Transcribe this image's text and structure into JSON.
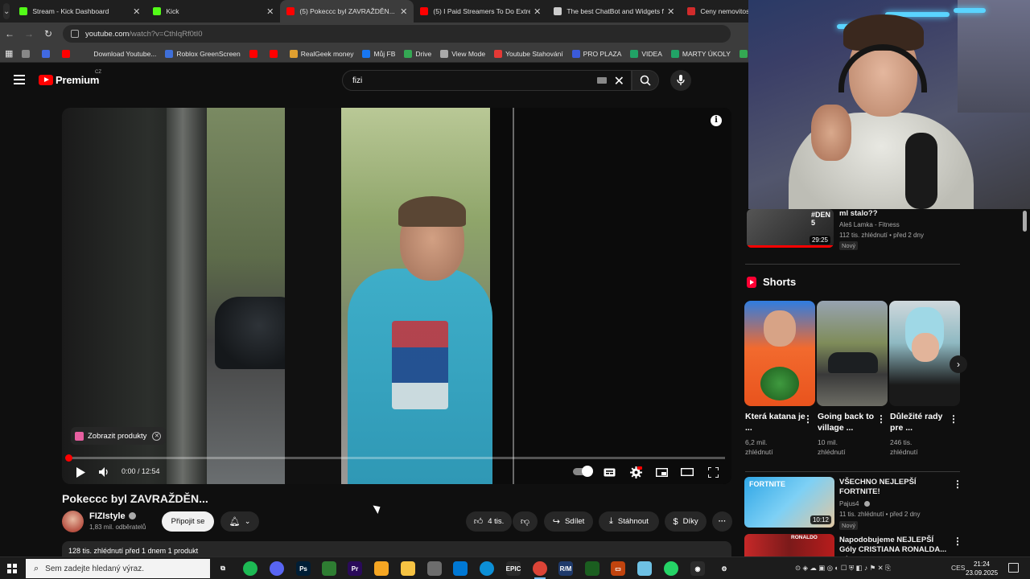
{
  "browser": {
    "tabs": [
      {
        "title": "Stream - Kick Dashboard",
        "color": "#53fc18",
        "active": false
      },
      {
        "title": "Kick",
        "color": "#53fc18",
        "active": false
      },
      {
        "title": "(5) Pokeccc byl ZAVRAŽDĚN...",
        "color": "#ff0000",
        "active": true
      },
      {
        "title": "(5) I Paid Streamers To Do Extre",
        "color": "#ff0000",
        "active": false
      },
      {
        "title": "The best ChatBot and Widgets f",
        "color": "#cccccc",
        "active": false
      },
      {
        "title": "Ceny nemovitostí ČR 202",
        "color": "#d12b2b",
        "active": false
      }
    ],
    "url_host": "youtube.com",
    "url_path": "/watch?v=CthIqRf0tI0",
    "bookmarks": [
      {
        "label": "",
        "color": "#888888"
      },
      {
        "label": "",
        "color": "#4169e1"
      },
      {
        "label": "",
        "color": "#ff0000"
      },
      {
        "label": "Download Youtube...",
        "color": "#3c3c3c"
      },
      {
        "label": "Roblox GreenScreen",
        "color": "#3f6fd8"
      },
      {
        "label": "",
        "color": "#ff0000"
      },
      {
        "label": "",
        "color": "#ff0000"
      },
      {
        "label": "RealGeek money",
        "color": "#e0a030"
      },
      {
        "label": "Můj FB",
        "color": "#1877f2"
      },
      {
        "label": "Drive",
        "color": "#34a853"
      },
      {
        "label": "View Mode",
        "color": "#aaaaaa"
      },
      {
        "label": "Youtube Stahování",
        "color": "#e53935"
      },
      {
        "label": "PRO PLAZA",
        "color": "#3b5bdb"
      },
      {
        "label": "VIDEA",
        "color": "#21a366"
      },
      {
        "label": "MARTY ÚKOLY",
        "color": "#21a366"
      },
      {
        "label": "Dodo videa",
        "color": "#34a853"
      }
    ]
  },
  "youtube": {
    "logo_text": "Premium",
    "logo_region": "CZ",
    "search_value": "fizi",
    "player": {
      "product_chip": "Zobrazit produkty",
      "time": "0:00 / 12:54",
      "progress": 0.0
    },
    "video_title": "Pokeccc byl ZAVRAŽDĚN...",
    "channel": {
      "name": "FIZIstyle",
      "subs": "1,83 mil. odběratelů"
    },
    "join_label": "Připojit se",
    "like_count": "4 tis.",
    "share_label": "Sdílet",
    "download_label": "Stáhnout",
    "thanks_label": "Díky",
    "description": "128 tis. zhlédnutí  před 1 dnem  1 produkt"
  },
  "sidebar": {
    "top_video": {
      "title": "ml stalo??",
      "channel": "Aleš Lamka - Fitness",
      "meta": "112 tis. zhlédnutí • před 2 dny",
      "badge": "Nový",
      "duration": "29:25",
      "thumb_text": "#DEN 5"
    },
    "shorts_heading": "Shorts",
    "shorts": [
      {
        "title": "Která katana je ...",
        "views": "6,2 mil. zhlédnutí"
      },
      {
        "title": "Going back to village ...",
        "views": "10 mil. zhlédnutí"
      },
      {
        "title": "Důležité rady pre ...",
        "views": "246 tis. zhlédnutí"
      }
    ],
    "videos": [
      {
        "title": "VŠECHNO NEJLEPŠÍ FORTNITE!",
        "channel": "Pajus4",
        "meta": "11 tis. zhlédnutí • před 2 dny",
        "badge": "Nový",
        "duration": "10:12",
        "thumb_text": "FORTNITE"
      },
      {
        "title": "Napodobujeme NEJLEPŠÍ Góly CRISTIANA RONALDA... w/ ...",
        "channel": "",
        "meta": "",
        "badge": "",
        "duration": "",
        "thumb_text": "RONALDO"
      }
    ]
  },
  "taskbar": {
    "search_placeholder": "Sem zadejte hledaný výraz.",
    "language": "CES",
    "time": "21:24",
    "date": "23.09.2025"
  }
}
